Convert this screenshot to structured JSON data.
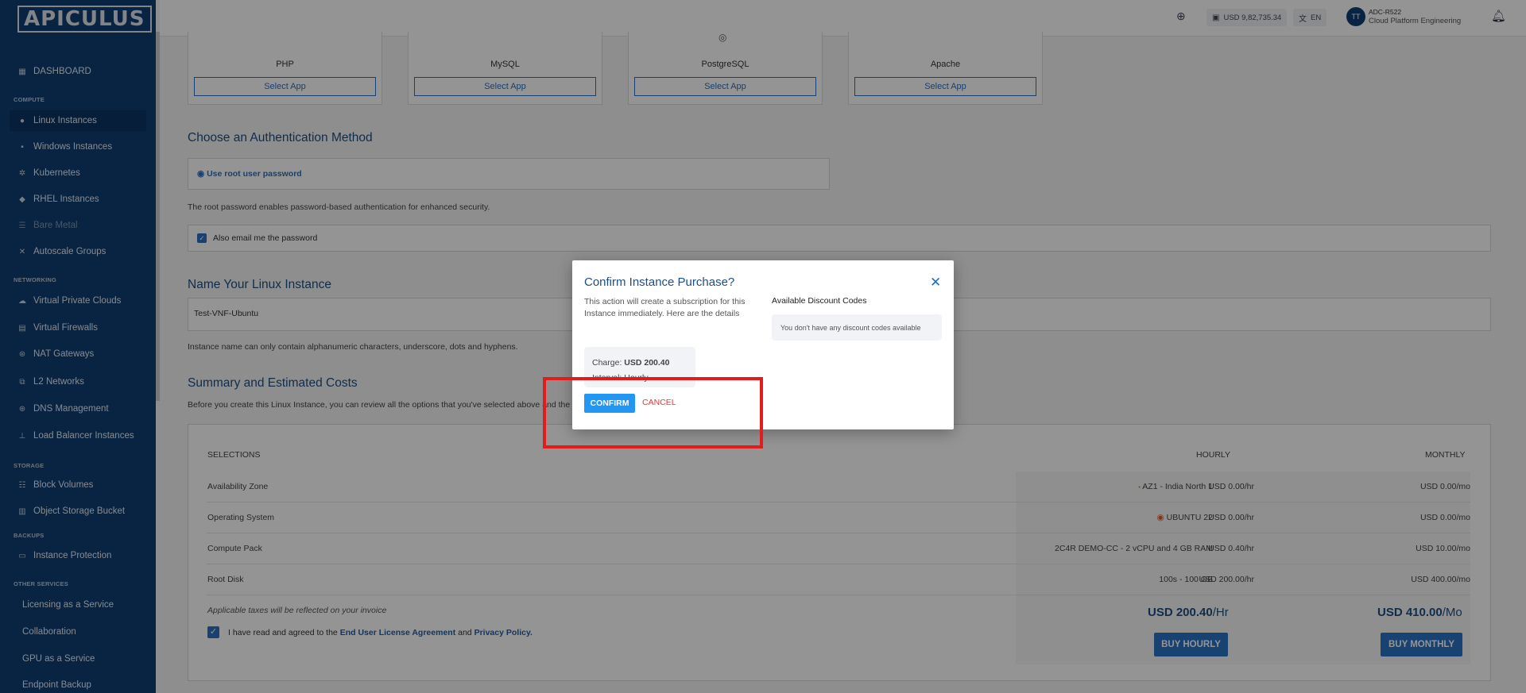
{
  "brand": {
    "logo": "APICULUS"
  },
  "sidebar": {
    "dashboard": "DASHBOARD",
    "sections": {
      "compute": "COMPUTE",
      "networking": "NETWORKING",
      "storage": "STORAGE",
      "backups": "BACKUPS",
      "other": "OTHER SERVICES"
    },
    "compute": [
      "Linux Instances",
      "Windows Instances",
      "Kubernetes",
      "RHEL Instances",
      "Bare Metal",
      "Autoscale Groups"
    ],
    "networking": [
      "Virtual Private Clouds",
      "Virtual Firewalls",
      "NAT Gateways",
      "L2 Networks",
      "DNS Management",
      "Load Balancer Instances"
    ],
    "storage": [
      "Block Volumes",
      "Object Storage Bucket"
    ],
    "backups": [
      "Instance Protection"
    ],
    "other": [
      "Licensing as a Service",
      "Collaboration",
      "GPU as a Service",
      "Endpoint Backup"
    ]
  },
  "topbar": {
    "balance": "USD 9,82,735.34",
    "language": "EN",
    "avatar_initials": "TT",
    "user_name": "ADC-R522",
    "user_org": "Cloud Platform Engineering"
  },
  "apps": [
    {
      "name": "PHP",
      "button": "Select App"
    },
    {
      "name": "MySQL",
      "button": "Select App"
    },
    {
      "name": "PostgreSQL",
      "button": "Select App"
    },
    {
      "name": "Apache",
      "button": "Select App"
    }
  ],
  "auth": {
    "title": "Choose an Authentication Method",
    "option": "Use root user password",
    "note": "The root password enables password-based authentication for enhanced security.",
    "email_label": "Also email me the password"
  },
  "instance_name": {
    "title": "Name Your Linux Instance",
    "value": "Test-VNF-Ubuntu",
    "note": "Instance name can only contain alphanumeric characters, underscore, dots and hyphens."
  },
  "summary": {
    "title": "Summary and Estimated Costs",
    "note": "Before you create this Linux Instance, you can review all the options that you've selected above and the",
    "headers": {
      "selections": "SELECTIONS",
      "hourly": "HOURLY",
      "monthly": "MONTHLY"
    },
    "rows": [
      {
        "label": "Availability Zone",
        "value": "AZ1 - India North 1",
        "hourly": "USD 0.00/hr",
        "monthly": "USD 0.00/mo"
      },
      {
        "label": "Operating System",
        "value": "UBUNTU 22",
        "hourly": "USD 0.00/hr",
        "monthly": "USD 0.00/mo"
      },
      {
        "label": "Compute Pack",
        "value": "2C4R DEMO-CC - 2 vCPU and 4 GB RAM",
        "hourly": "USD 0.40/hr",
        "monthly": "USD 10.00/mo"
      },
      {
        "label": "Root Disk",
        "value": "100s - 100 GB",
        "hourly": "USD 200.00/hr",
        "monthly": "USD 400.00/mo"
      }
    ],
    "tax_note": "Applicable taxes will be reflected on your invoice",
    "agree_prefix": "I have read and agreed to the",
    "eula": "End User License Agreement",
    "and": "and",
    "privacy": "Privacy Policy.",
    "total_hourly": "USD 200.40",
    "total_hourly_unit": "/Hr",
    "total_monthly": "USD 410.00",
    "total_monthly_unit": "/Mo",
    "buy_hourly": "BUY HOURLY",
    "buy_monthly": "BUY MONTHLY"
  },
  "modal": {
    "title": "Confirm Instance Purchase?",
    "description": "This action will create a subscription for this Instance immediately. Here are the details",
    "charge_label": "Charge:",
    "charge_value": "USD 200.40",
    "interval_label": "Interval:",
    "interval_value": "Hourly",
    "confirm": "CONFIRM",
    "cancel": "CANCEL",
    "discount_title": "Available Discount Codes",
    "discount_empty": "You don't have any discount codes available"
  },
  "colors": {
    "sidebar": "#0e3e72",
    "accent": "#2a73c4",
    "confirm": "#2196f3",
    "cancel": "#e53935",
    "highlight": "#e31b1b"
  }
}
